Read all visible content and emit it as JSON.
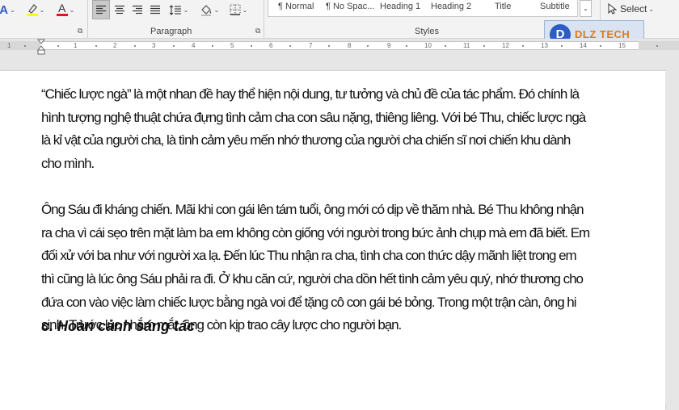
{
  "ribbon": {
    "font_tools": {
      "text_effects": "A",
      "font_color": "A",
      "caret": "⌄"
    },
    "paragraph": {
      "label": "Paragraph"
    },
    "styles": {
      "label": "Styles",
      "items": [
        "¶ Normal",
        "¶ No Spac...",
        "Heading 1",
        "Heading 2",
        "Title",
        "Subtitle"
      ]
    },
    "editing": {
      "select_label": "Select",
      "select_caret": "⌄"
    }
  },
  "ruler": {
    "numbers": [
      "1",
      "1",
      "2",
      "3",
      "4",
      "5",
      "6",
      "7",
      "8",
      "9",
      "10",
      "11",
      "12",
      "13",
      "14",
      "15"
    ]
  },
  "document": {
    "paragraphs": [
      "“Chiếc lược ngà” là một nhan đề hay thể hiện nội dung, tư tưởng và chủ đề của tác phẩm. Đó chính là hình tượng nghệ thuật chứa đựng tình cảm cha con sâu nặng, thiêng liêng. Với bé Thu, chiếc lược ngà là kỉ vật của người cha, là tình cảm yêu mến nhớ thương của người cha chiến sĩ nơi chiến khu dành cho mình.",
      "Ông Sáu đi kháng chiến. Mãi khi con gái lên tám tuổi, ông mới có dịp về thăm nhà. Bé Thu không nhận ra cha vì cái sẹo trên mặt làm ba em không còn giống với người trong bức ảnh chụp mà em đã biết. Em đối xử với ba như với người xa lạ. Đến lúc Thu nhận ra cha, tình cha con thức dậy mãnh liệt trong em thì cũng là lúc ông Sáu phải ra đi. Ở khu căn cứ, người cha dồn hết tình cảm yêu quý, nhớ thương cho đứa con vào việc làm chiếc lược bằng ngà voi để tặng cô con gái bé bỏng. Trong một trận càn, ông hi sinh. Trước lúc nhắm mắt, ông còn kịp trao cây lược cho người bạn."
    ],
    "heading": "c. Hoàn cảnh sáng tác"
  },
  "watermark": {
    "mark": "D",
    "text": "DLZ TECH"
  },
  "colors": {
    "accent": "#2e5bc4",
    "font_color_bar": "#e81123",
    "highlight_bar": "#ffff00",
    "logo_text": "#e07b1a"
  }
}
